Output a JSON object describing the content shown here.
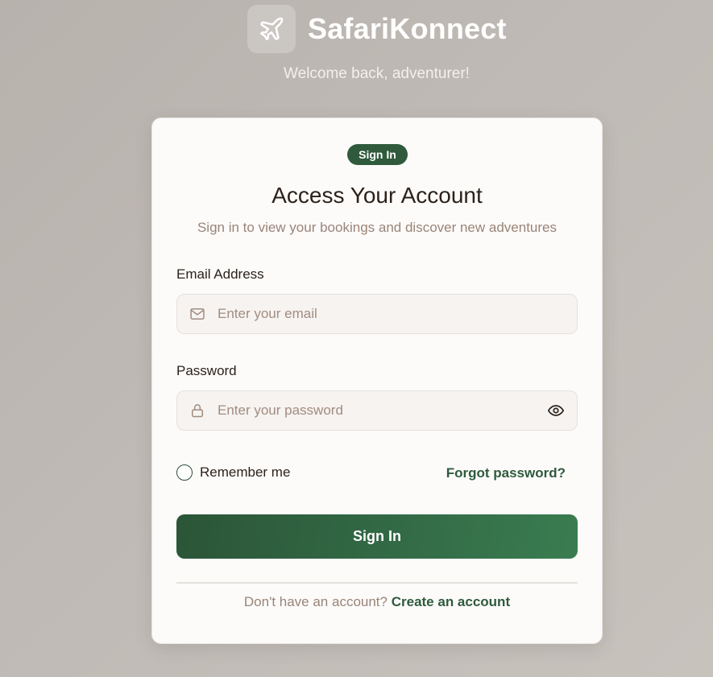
{
  "brand": {
    "name": "SafariKonnect",
    "logo_icon": "airplane-icon"
  },
  "welcome": "Welcome back, adventurer!",
  "card": {
    "badge": "Sign In",
    "title": "Access Your Account",
    "subtitle": "Sign in to view your bookings and discover new adventures"
  },
  "form": {
    "email": {
      "label": "Email Address",
      "placeholder": "Enter your email",
      "value": "",
      "icon": "mail-icon"
    },
    "password": {
      "label": "Password",
      "placeholder": "Enter your password",
      "value": "",
      "icon": "lock-icon",
      "toggle_icon": "eye-icon"
    },
    "remember_label": "Remember me",
    "forgot_label": "Forgot password?",
    "submit_label": "Sign In"
  },
  "footer": {
    "text": "Don't have an account?",
    "link": "Create an account"
  },
  "colors": {
    "accent": "#2f5a3c",
    "background": "#bfbab5",
    "card": "#fcfbfa",
    "muted_text": "#9a8477"
  }
}
